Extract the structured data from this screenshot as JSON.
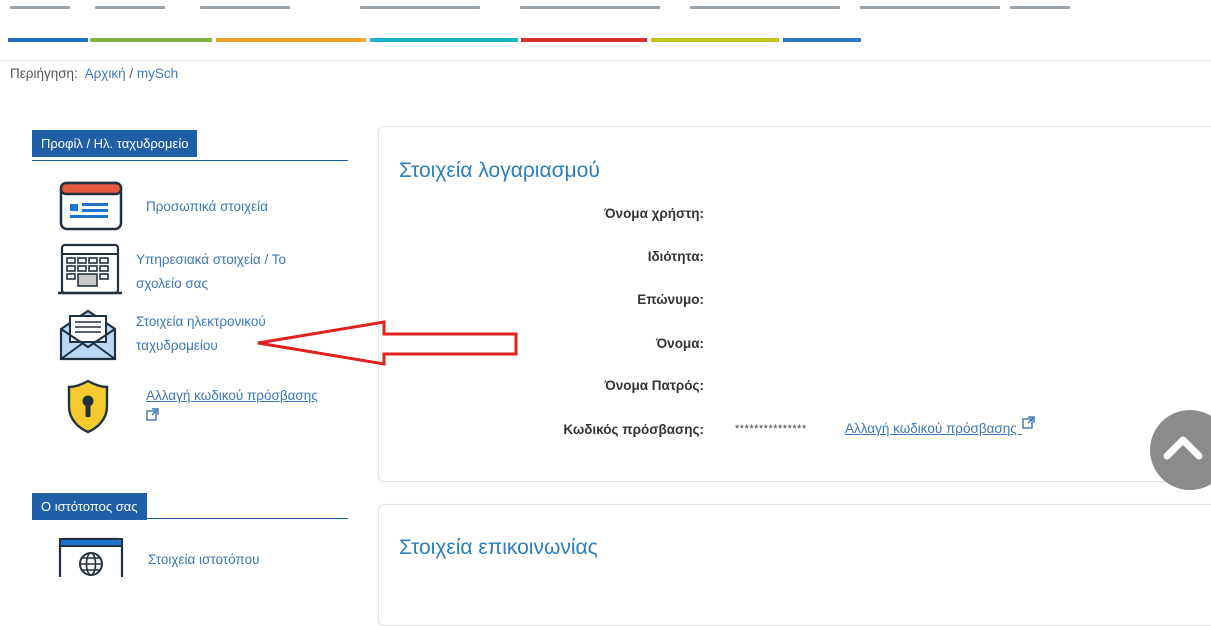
{
  "breadcrumb": {
    "label": "Περιήγηση:",
    "home": "Αρχική",
    "separator": "/",
    "current": "mySch"
  },
  "colors": {
    "bars": [
      "#1e6fbe",
      "#7fb441",
      "#f0a32c",
      "#18b7c4",
      "#d8342d",
      "#c2c31c",
      "#2f77c5"
    ],
    "section_blue": "#1f5fa8",
    "link": "#3b78b5",
    "title": "#2c7ebd",
    "annotation_arrow": "#dd2222"
  },
  "sidebar": {
    "section1": {
      "title": "Προφίλ / Ηλ. ταχυδρομείο",
      "items": [
        {
          "label": "Προσωπικά στοιχεία",
          "icon": "id-card-icon"
        },
        {
          "label_line1": "Υπηρεσιακά στοιχεία / Το",
          "label_line2": "σχολείο σας",
          "icon": "building-icon"
        },
        {
          "label_line1": "Στοιχεία ηλεκτρονικού",
          "label_line2": "ταχυδρομείου",
          "icon": "envelope-icon"
        },
        {
          "label": "Αλλαγή κωδικού πρόσβασης",
          "icon": "shield-keyhole-icon",
          "trailing_icon": "external-link-icon"
        }
      ]
    },
    "section2": {
      "title": "Ο ιστότοπος σας",
      "items": [
        {
          "label": "Στοιχεία ιστοτόπου",
          "icon": "globe-window-icon"
        }
      ]
    }
  },
  "account": {
    "title": "Στοιχεία λογαριασμού",
    "fields": [
      {
        "label": "Όνομα χρήστη:",
        "value": ""
      },
      {
        "label": "Ιδιότητα:",
        "value": ""
      },
      {
        "label": "Επώνυμο:",
        "value": ""
      },
      {
        "label": "Όνομα:",
        "value": ""
      },
      {
        "label": "Όνομα Πατρός:",
        "value": ""
      },
      {
        "label": "Κωδικός πρόσβασης:",
        "value": "***************"
      }
    ],
    "change_password_link": "Αλλαγή κωδικού πρόσβασης"
  },
  "contact": {
    "title": "Στοιχεία επικοινωνίας"
  },
  "scroll_top": {
    "icon": "chevron-up-icon"
  }
}
